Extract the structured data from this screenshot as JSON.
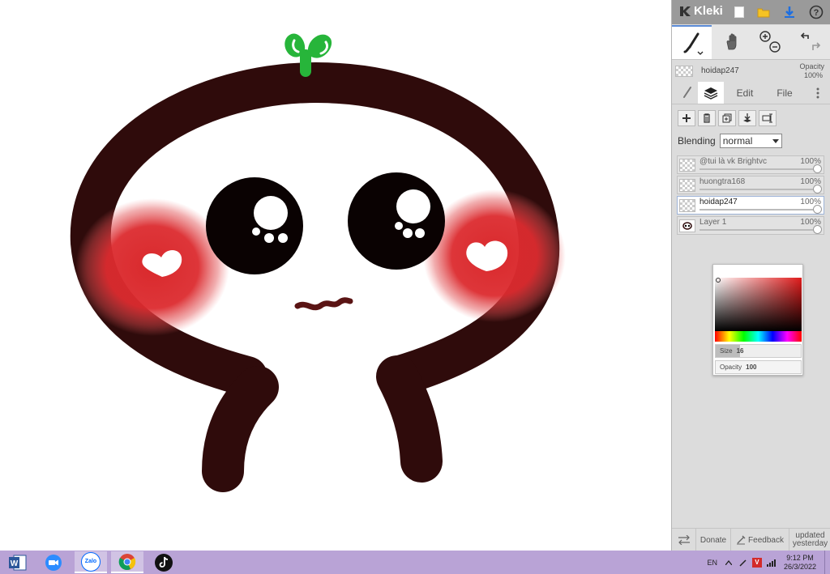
{
  "app": {
    "name": "Kleki"
  },
  "toolbar": {
    "new_image_icon": "new-image-icon",
    "open_icon": "open-folder-icon",
    "save_icon": "download-icon",
    "help_icon": "help-icon",
    "tools": [
      {
        "name": "brush",
        "icon": "brush-icon",
        "active": true
      },
      {
        "name": "hand",
        "icon": "hand-icon",
        "active": false
      },
      {
        "name": "zoom",
        "icon": "zoom-icon",
        "active": false
      },
      {
        "name": "undo-redo",
        "icon": "undo-redo-icon",
        "active": false
      }
    ]
  },
  "current_layer": {
    "name": "hoidap247",
    "opacity_label": "Opacity",
    "opacity_value": "100%"
  },
  "tabs": [
    {
      "label": "",
      "icon": "brush-icon"
    },
    {
      "label": "",
      "icon": "layers-icon",
      "active": true
    },
    {
      "label": "Edit"
    },
    {
      "label": "File"
    },
    {
      "label": "",
      "icon": "more-icon"
    }
  ],
  "layer_tools": [
    "add-layer-icon",
    "delete-layer-icon",
    "duplicate-layer-icon",
    "merge-layer-icon",
    "rename-layer-icon"
  ],
  "blending": {
    "label": "Blending",
    "value": "normal"
  },
  "layers": [
    {
      "name": "@tui là vk Brightvc",
      "opacity": "100%",
      "selected": false
    },
    {
      "name": "huongtra168",
      "opacity": "100%",
      "selected": false
    },
    {
      "name": "hoidap247",
      "opacity": "100%",
      "selected": true
    },
    {
      "name": "Layer 1",
      "opacity": "100%",
      "selected": false
    }
  ],
  "color_picker": {
    "color": "#e01b1b",
    "size_label": "Size",
    "size_value": "16",
    "opacity_label": "Opacity",
    "opacity_value": "100"
  },
  "footer": {
    "donate": "Donate",
    "feedback": "Feedback",
    "updated_line1": "updated",
    "updated_line2": "yesterday"
  },
  "taskbar": {
    "apps": [
      "Word",
      "Zoom",
      "Zalo",
      "Chrome",
      "TikTok"
    ],
    "zalo_label": "Zalo",
    "language": "EN",
    "time": "9:12 PM",
    "date": "26/3/2022"
  },
  "drawing_colors": {
    "outline": "#2f0b0b",
    "blush": "#d9292c",
    "eyes": "#0a0202",
    "sprout": "#27b53a"
  }
}
